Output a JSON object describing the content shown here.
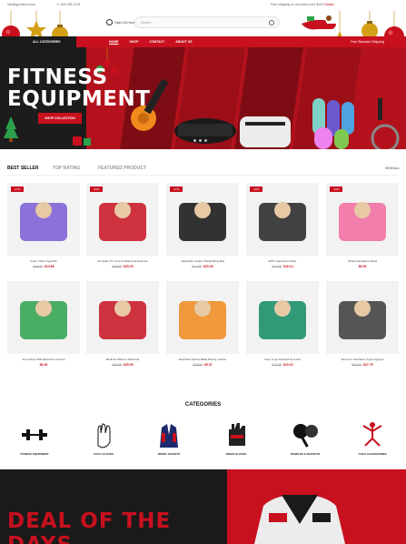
{
  "topbar": {
    "email": "info@gymstore.com",
    "phone": "+1 800 555 1234",
    "shipping_text": "Free shipping on all orders over $100",
    "shipping_link": "Details"
  },
  "header": {
    "hours": "Open 24 Hours",
    "search_placeholder": "Search..."
  },
  "nav": {
    "all_categories": "ALL CATEGORIES",
    "menu": [
      "HOME",
      "SHOP",
      "CONTACT",
      "ABOUT US"
    ],
    "free_shipping": "Free Standard Shipping"
  },
  "hero": {
    "title_line1": "FITNESS",
    "title_line2": "EQUIPMENT",
    "cta": "SHOP COLLECTION"
  },
  "tabs": {
    "items": [
      "BEST SELLER",
      "TOP RATING",
      "FEATURED PRODUCT"
    ],
    "view_all": "VIEW ALL"
  },
  "products": [
    {
      "name": "Foam Thick Yoga Mat",
      "old": "$19.99",
      "new": "$14.66",
      "badge": "-27%",
      "color": "#7a5bd6"
    },
    {
      "name": "Ab Roller Pro Core & Abdominal Exercise",
      "old": "$35.99",
      "new": "$25.29",
      "badge": "-30%",
      "color": "#c8101e"
    },
    {
      "name": "Adjustable Leather Weightlifting Belt",
      "old": "$27.99",
      "new": "$20.49",
      "badge": "-27%",
      "color": "#111111"
    },
    {
      "name": "EPP Yoga Foam Roller",
      "old": "$23.99",
      "new": "$16.14",
      "badge": "-33%",
      "color": "#222222"
    },
    {
      "name": "Infinite Resistance Band",
      "old": "",
      "new": "$8.99",
      "badge": "-19%",
      "color": "#f26aa0"
    },
    {
      "name": "Jump Rope With Electronic Counter",
      "old": "",
      "new": "$6.46",
      "badge": "",
      "color": "#2ca14a"
    },
    {
      "name": "Medicine Ball For Workouts",
      "old": "$39.99",
      "new": "$29.39",
      "badge": "",
      "color": "#c8101e"
    },
    {
      "name": "Motorbike Gloves Black Racing Leather",
      "old": "$13.99",
      "new": "$9.37",
      "badge": "",
      "color": "#f08a1c"
    },
    {
      "name": "Sexy Yoga Tracksuit Gym Set",
      "old": "$13.99",
      "new": "$10.32",
      "badge": "",
      "color": "#0f8a63"
    },
    {
      "name": "Women's Seamless Yoga Leggings",
      "old": "$39.99",
      "new": "$27.79",
      "badge": "",
      "color": "#3a3a3a"
    }
  ],
  "categories": {
    "title": "CATEGORIES",
    "items": [
      {
        "label": "FITNESS EQUIPMENT",
        "icon": "dumbbell-icon"
      },
      {
        "label": "GOLF GLOVES",
        "icon": "glove-icon"
      },
      {
        "label": "BIKER JACKETS",
        "icon": "jacket-icon"
      },
      {
        "label": "BIKER GLOVES",
        "icon": "biker-glove-icon"
      },
      {
        "label": "PADDLES & RACKETS",
        "icon": "paddle-icon"
      },
      {
        "label": "YOGA ACCESSORIES",
        "icon": "yoga-icon"
      }
    ]
  },
  "deal": {
    "line1": "DEAL OF THE",
    "line2": "DAYS"
  },
  "colors": {
    "accent": "#c8101e",
    "dark": "#1a1a1a"
  }
}
